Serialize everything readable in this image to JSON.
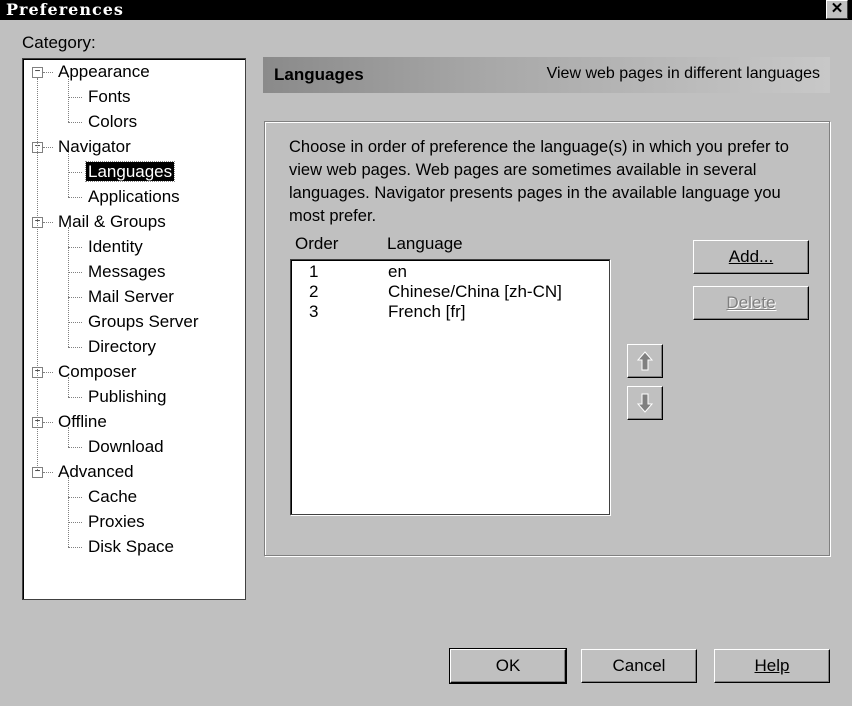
{
  "window": {
    "title": "Preferences",
    "close_glyph": "✕"
  },
  "category_label": "Category:",
  "tree": {
    "nodes": [
      {
        "label": "Appearance",
        "level": 0,
        "expander": "−"
      },
      {
        "label": "Fonts",
        "level": 1
      },
      {
        "label": "Colors",
        "level": 1
      },
      {
        "label": "Navigator",
        "level": 0,
        "expander": "−"
      },
      {
        "label": "Languages",
        "level": 1,
        "selected": true
      },
      {
        "label": "Applications",
        "level": 1
      },
      {
        "label": "Mail & Groups",
        "level": 0,
        "expander": "−"
      },
      {
        "label": "Identity",
        "level": 1
      },
      {
        "label": "Messages",
        "level": 1
      },
      {
        "label": "Mail Server",
        "level": 1
      },
      {
        "label": "Groups Server",
        "level": 1
      },
      {
        "label": "Directory",
        "level": 1
      },
      {
        "label": "Composer",
        "level": 0,
        "expander": "−"
      },
      {
        "label": "Publishing",
        "level": 1
      },
      {
        "label": "Offline",
        "level": 0,
        "expander": "−"
      },
      {
        "label": "Download",
        "level": 1
      },
      {
        "label": "Advanced",
        "level": 0,
        "expander": "−"
      },
      {
        "label": "Cache",
        "level": 1
      },
      {
        "label": "Proxies",
        "level": 1
      },
      {
        "label": "Disk Space",
        "level": 1
      }
    ]
  },
  "panel": {
    "title": "Languages",
    "subtitle": "View web pages in different languages",
    "description": "Choose in order of preference the language(s) in which you prefer to view web pages. Web pages are sometimes available in several languages. Navigator presents pages in the available language you most prefer.",
    "columns": {
      "order": "Order",
      "language": "Language"
    },
    "rows": [
      {
        "order": "1",
        "language": "en"
      },
      {
        "order": "2",
        "language": "Chinese/China [zh-CN]"
      },
      {
        "order": "3",
        "language": "French [fr]"
      }
    ],
    "add_label": "Add...",
    "delete_label": "Delete"
  },
  "footer": {
    "ok_label": "OK",
    "cancel_label": "Cancel",
    "help_label": "Help"
  }
}
